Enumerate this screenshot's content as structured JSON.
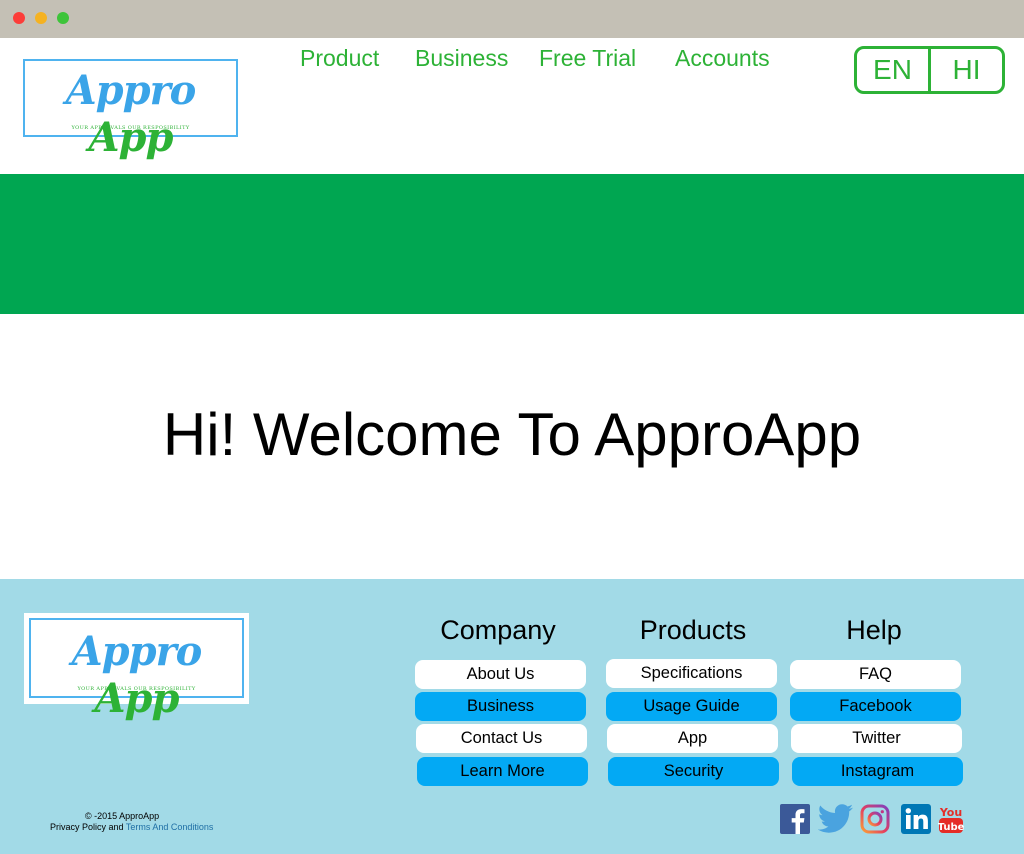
{
  "header": {
    "logo_word_a": "Appro",
    "logo_word_b": "App",
    "logo_tagline": "YOUR APPROVALS OUR RESPOSIBILITY",
    "nav": [
      "Product",
      "Business",
      "Free Trial",
      "Accounts"
    ],
    "languages": [
      "EN",
      "HI"
    ]
  },
  "main": {
    "welcome": "Hi! Welcome To ApproApp"
  },
  "footer": {
    "columns": [
      {
        "title": "Company",
        "links": [
          "About Us",
          "Business",
          "Contact Us",
          "Learn More"
        ]
      },
      {
        "title": "Products",
        "links": [
          "Specifications",
          "Usage Guide",
          "App",
          "Security"
        ]
      },
      {
        "title": "Help",
        "links": [
          "FAQ",
          "Facebook",
          "Twitter",
          "Instagram"
        ]
      }
    ],
    "copyright_line": "© -2015  ApproApp",
    "privacy_text": "Privacy Policy and ",
    "terms_text": "Terms And Conditions",
    "social_icons": [
      "facebook-icon",
      "twitter-icon",
      "instagram-icon",
      "linkedin-icon",
      "youtube-icon"
    ]
  },
  "colors": {
    "brand_green": "#2db236",
    "banner_green": "#00a651",
    "footer_bg": "#a2dae7",
    "pill_blue": "#03a9f4",
    "logo_blue": "#3aa4e8"
  }
}
